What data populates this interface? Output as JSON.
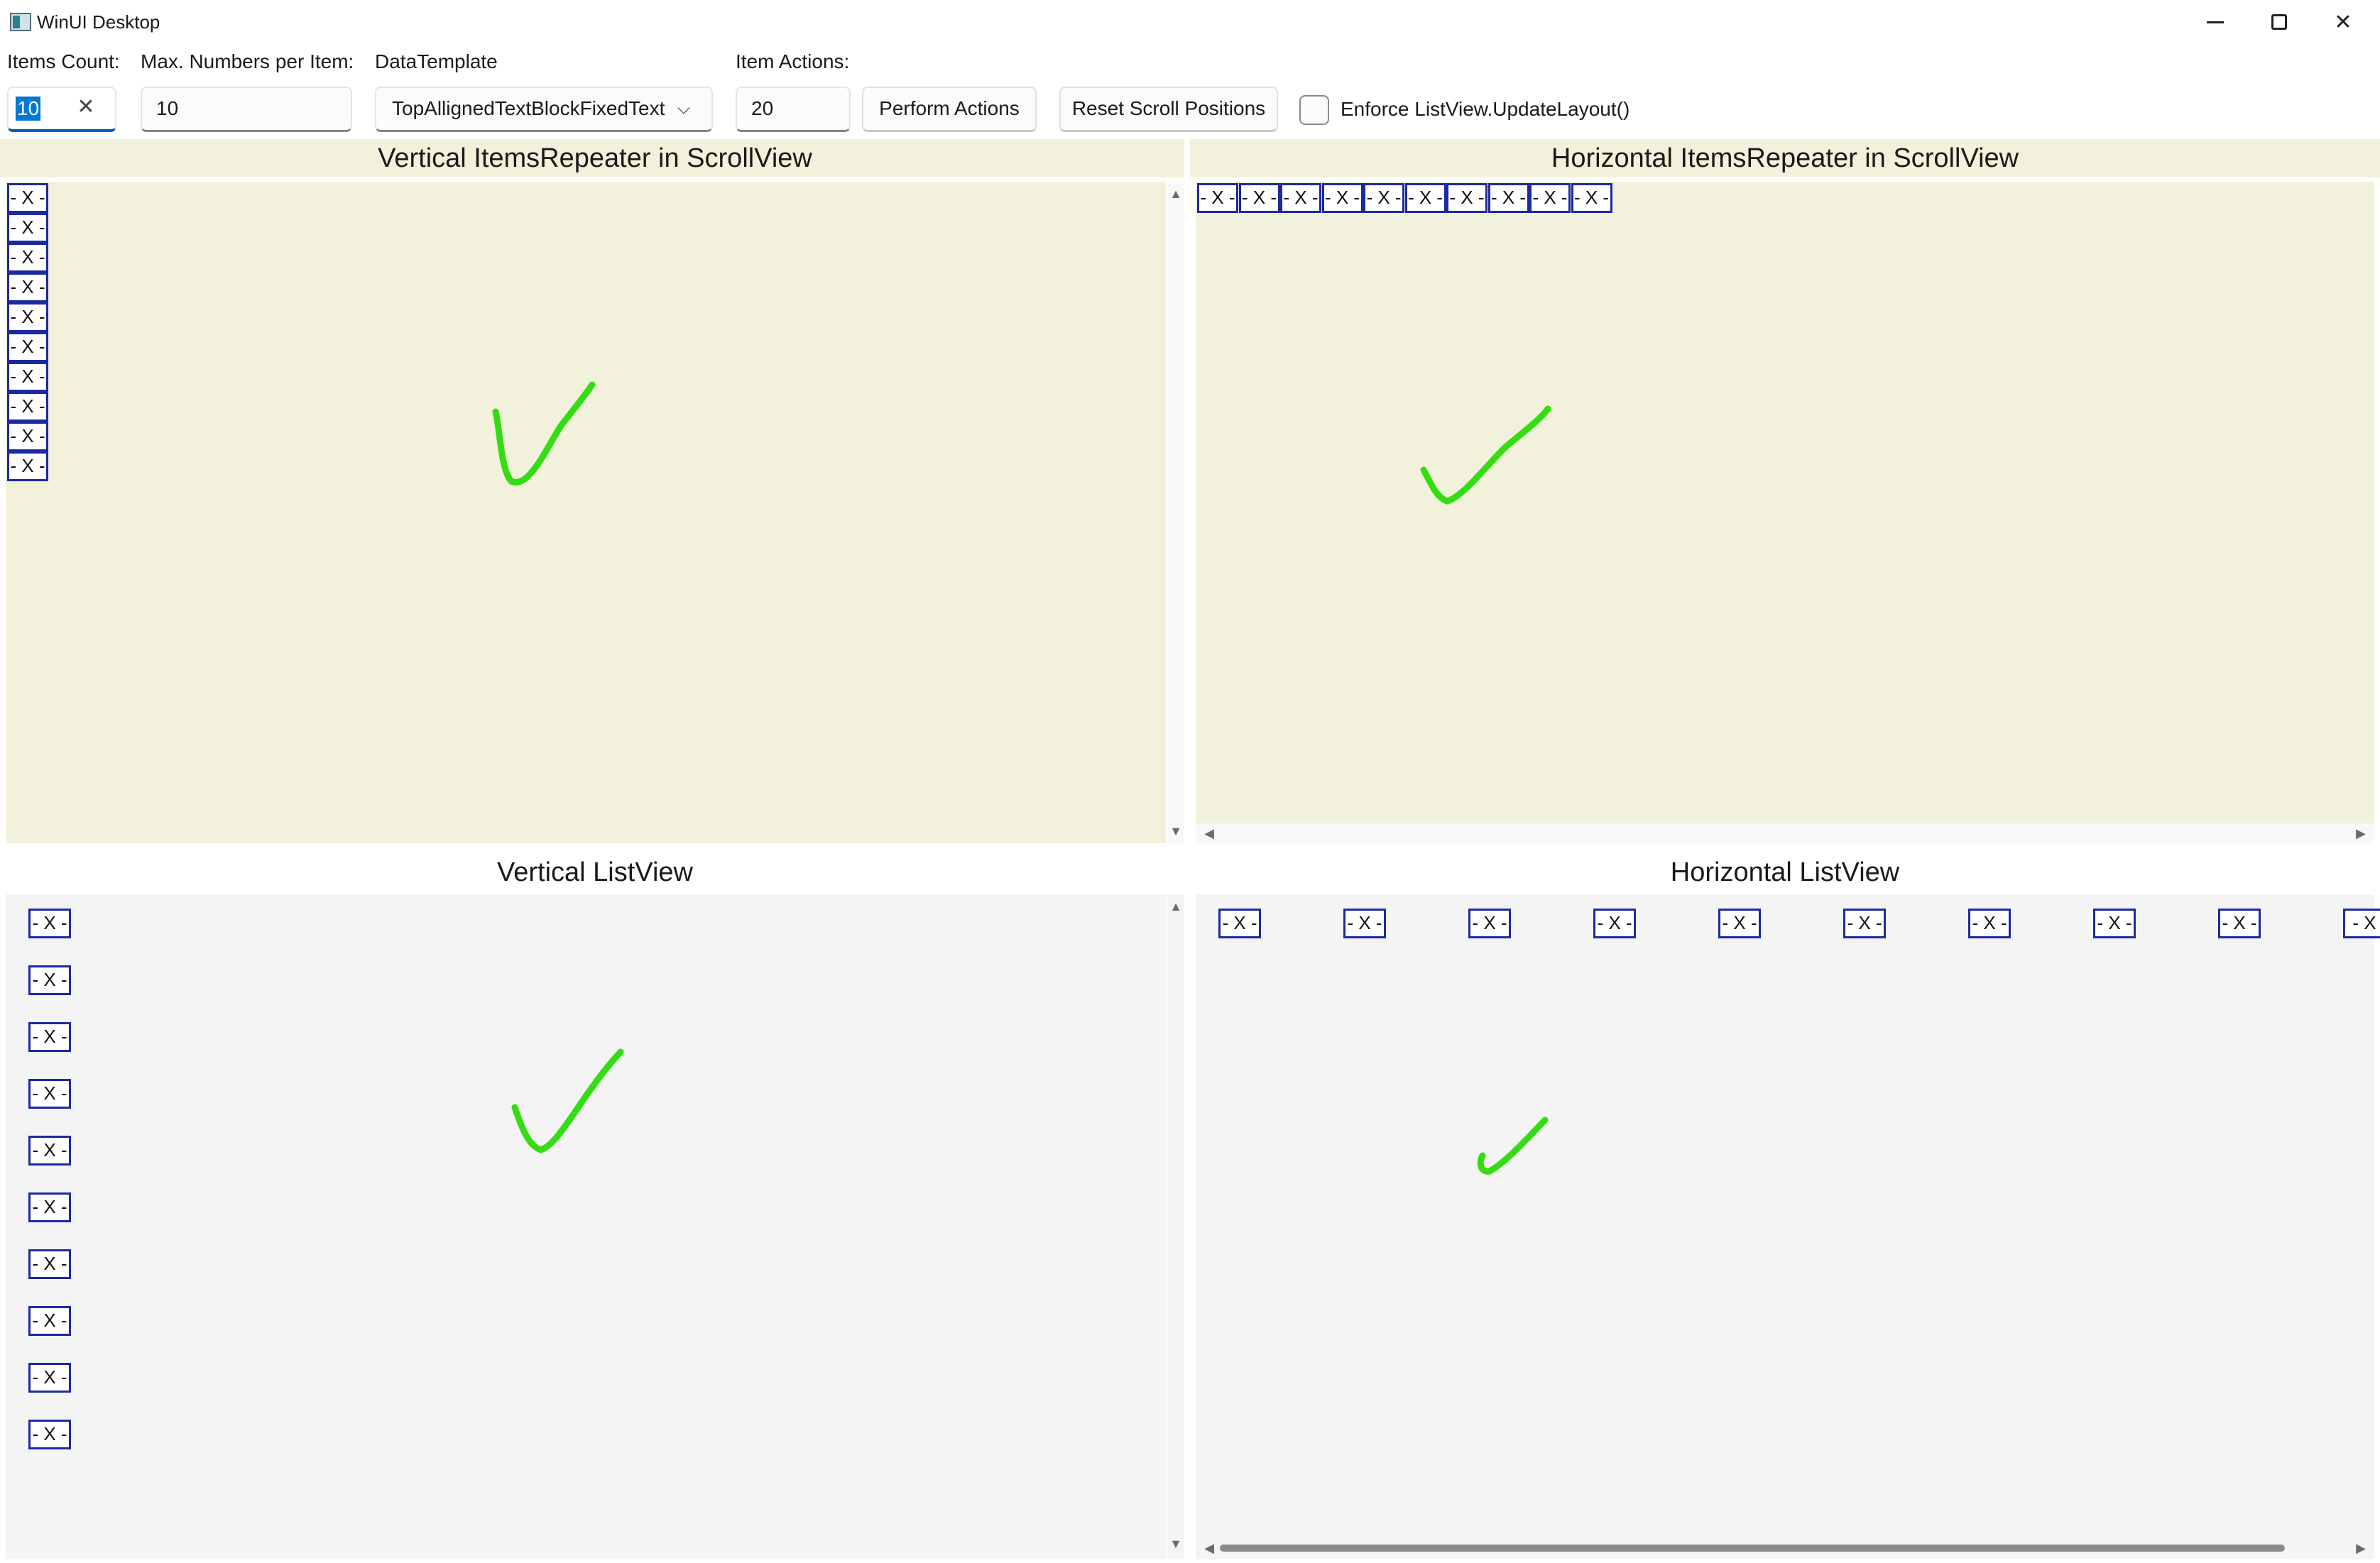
{
  "window": {
    "title": "WinUI Desktop",
    "minimize_icon": "minimize-icon",
    "maximize_icon": "maximize-icon",
    "close_icon": "close-icon",
    "close_glyph": "✕"
  },
  "toolbar": {
    "items_count": {
      "label": "Items Count:",
      "value": "10",
      "clear_glyph": "✕"
    },
    "max_numbers": {
      "label": "Max. Numbers per Item:",
      "value": "10"
    },
    "data_template": {
      "label": "DataTemplate",
      "selected": "TopAllignedTextBlockFixedText",
      "chevron_glyph": "⌵"
    },
    "item_actions": {
      "label": "Item Actions:",
      "value": "20"
    },
    "perform_button": "Perform Actions",
    "reset_button": "Reset Scroll Positions",
    "enforce_checkbox": {
      "label": "Enforce ListView.UpdateLayout()",
      "checked": false
    }
  },
  "panels": {
    "vertical_repeater": {
      "title": "Vertical ItemsRepeater in ScrollView",
      "background": "#f2f2dc"
    },
    "horizontal_repeater": {
      "title": "Horizontal ItemsRepeater in ScrollView",
      "background": "#f2f2dc"
    },
    "vertical_listview": {
      "title": "Vertical ListView",
      "background": "#f4f4f4"
    },
    "horizontal_listview": {
      "title": "Horizontal ListView",
      "background": "#f4f4f4"
    }
  },
  "items": {
    "vertical_repeater": [
      "- X -",
      "- X -",
      "- X -",
      "- X -",
      "- X -",
      "- X -",
      "- X -",
      "- X -",
      "- X -",
      "- X -"
    ],
    "horizontal_repeater": [
      "- X -",
      "- X -",
      "- X -",
      "- X -",
      "- X -",
      "- X -",
      "- X -",
      "- X -",
      "- X -",
      "- X -"
    ],
    "vertical_listview": [
      "- X -",
      "- X -",
      "- X -",
      "- X -",
      "- X -",
      "- X -",
      "- X -",
      "- X -",
      "- X -",
      "- X -"
    ],
    "horizontal_listview": [
      "- X -",
      "- X -",
      "- X -",
      "- X -",
      "- X -",
      "- X -",
      "- X -",
      "- X -",
      "- X -",
      "- X"
    ]
  },
  "scroll_arrows": {
    "up": "▲",
    "down": "▼",
    "left": "◀",
    "right": "▶"
  },
  "colors": {
    "item_border": "#1c2aa0",
    "check_mark": "#33dd11",
    "accent": "#0078d4"
  }
}
